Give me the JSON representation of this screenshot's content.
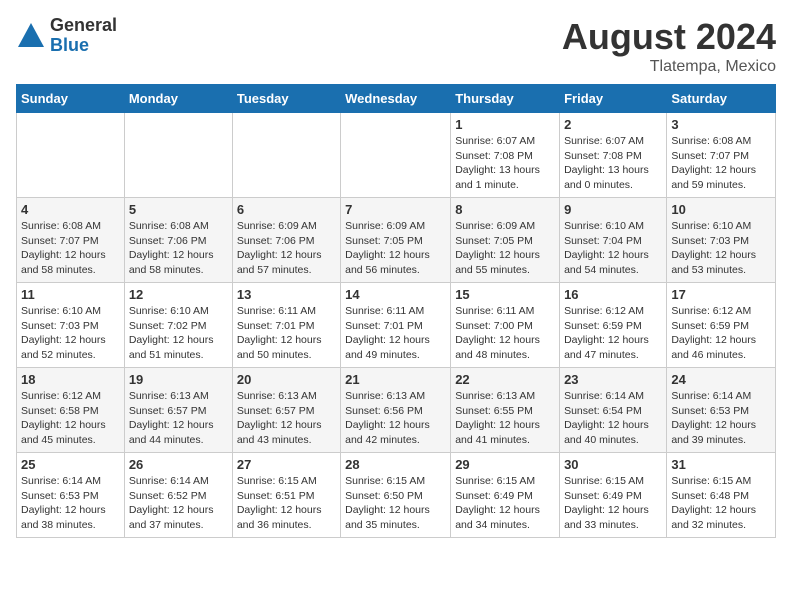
{
  "logo": {
    "general": "General",
    "blue": "Blue"
  },
  "title": {
    "month_year": "August 2024",
    "location": "Tlatempa, Mexico"
  },
  "days_of_week": [
    "Sunday",
    "Monday",
    "Tuesday",
    "Wednesday",
    "Thursday",
    "Friday",
    "Saturday"
  ],
  "weeks": [
    [
      {
        "day": "",
        "info": ""
      },
      {
        "day": "",
        "info": ""
      },
      {
        "day": "",
        "info": ""
      },
      {
        "day": "",
        "info": ""
      },
      {
        "day": "1",
        "info": "Sunrise: 6:07 AM\nSunset: 7:08 PM\nDaylight: 13 hours\nand 1 minute."
      },
      {
        "day": "2",
        "info": "Sunrise: 6:07 AM\nSunset: 7:08 PM\nDaylight: 13 hours\nand 0 minutes."
      },
      {
        "day": "3",
        "info": "Sunrise: 6:08 AM\nSunset: 7:07 PM\nDaylight: 12 hours\nand 59 minutes."
      }
    ],
    [
      {
        "day": "4",
        "info": "Sunrise: 6:08 AM\nSunset: 7:07 PM\nDaylight: 12 hours\nand 58 minutes."
      },
      {
        "day": "5",
        "info": "Sunrise: 6:08 AM\nSunset: 7:06 PM\nDaylight: 12 hours\nand 58 minutes."
      },
      {
        "day": "6",
        "info": "Sunrise: 6:09 AM\nSunset: 7:06 PM\nDaylight: 12 hours\nand 57 minutes."
      },
      {
        "day": "7",
        "info": "Sunrise: 6:09 AM\nSunset: 7:05 PM\nDaylight: 12 hours\nand 56 minutes."
      },
      {
        "day": "8",
        "info": "Sunrise: 6:09 AM\nSunset: 7:05 PM\nDaylight: 12 hours\nand 55 minutes."
      },
      {
        "day": "9",
        "info": "Sunrise: 6:10 AM\nSunset: 7:04 PM\nDaylight: 12 hours\nand 54 minutes."
      },
      {
        "day": "10",
        "info": "Sunrise: 6:10 AM\nSunset: 7:03 PM\nDaylight: 12 hours\nand 53 minutes."
      }
    ],
    [
      {
        "day": "11",
        "info": "Sunrise: 6:10 AM\nSunset: 7:03 PM\nDaylight: 12 hours\nand 52 minutes."
      },
      {
        "day": "12",
        "info": "Sunrise: 6:10 AM\nSunset: 7:02 PM\nDaylight: 12 hours\nand 51 minutes."
      },
      {
        "day": "13",
        "info": "Sunrise: 6:11 AM\nSunset: 7:01 PM\nDaylight: 12 hours\nand 50 minutes."
      },
      {
        "day": "14",
        "info": "Sunrise: 6:11 AM\nSunset: 7:01 PM\nDaylight: 12 hours\nand 49 minutes."
      },
      {
        "day": "15",
        "info": "Sunrise: 6:11 AM\nSunset: 7:00 PM\nDaylight: 12 hours\nand 48 minutes."
      },
      {
        "day": "16",
        "info": "Sunrise: 6:12 AM\nSunset: 6:59 PM\nDaylight: 12 hours\nand 47 minutes."
      },
      {
        "day": "17",
        "info": "Sunrise: 6:12 AM\nSunset: 6:59 PM\nDaylight: 12 hours\nand 46 minutes."
      }
    ],
    [
      {
        "day": "18",
        "info": "Sunrise: 6:12 AM\nSunset: 6:58 PM\nDaylight: 12 hours\nand 45 minutes."
      },
      {
        "day": "19",
        "info": "Sunrise: 6:13 AM\nSunset: 6:57 PM\nDaylight: 12 hours\nand 44 minutes."
      },
      {
        "day": "20",
        "info": "Sunrise: 6:13 AM\nSunset: 6:57 PM\nDaylight: 12 hours\nand 43 minutes."
      },
      {
        "day": "21",
        "info": "Sunrise: 6:13 AM\nSunset: 6:56 PM\nDaylight: 12 hours\nand 42 minutes."
      },
      {
        "day": "22",
        "info": "Sunrise: 6:13 AM\nSunset: 6:55 PM\nDaylight: 12 hours\nand 41 minutes."
      },
      {
        "day": "23",
        "info": "Sunrise: 6:14 AM\nSunset: 6:54 PM\nDaylight: 12 hours\nand 40 minutes."
      },
      {
        "day": "24",
        "info": "Sunrise: 6:14 AM\nSunset: 6:53 PM\nDaylight: 12 hours\nand 39 minutes."
      }
    ],
    [
      {
        "day": "25",
        "info": "Sunrise: 6:14 AM\nSunset: 6:53 PM\nDaylight: 12 hours\nand 38 minutes."
      },
      {
        "day": "26",
        "info": "Sunrise: 6:14 AM\nSunset: 6:52 PM\nDaylight: 12 hours\nand 37 minutes."
      },
      {
        "day": "27",
        "info": "Sunrise: 6:15 AM\nSunset: 6:51 PM\nDaylight: 12 hours\nand 36 minutes."
      },
      {
        "day": "28",
        "info": "Sunrise: 6:15 AM\nSunset: 6:50 PM\nDaylight: 12 hours\nand 35 minutes."
      },
      {
        "day": "29",
        "info": "Sunrise: 6:15 AM\nSunset: 6:49 PM\nDaylight: 12 hours\nand 34 minutes."
      },
      {
        "day": "30",
        "info": "Sunrise: 6:15 AM\nSunset: 6:49 PM\nDaylight: 12 hours\nand 33 minutes."
      },
      {
        "day": "31",
        "info": "Sunrise: 6:15 AM\nSunset: 6:48 PM\nDaylight: 12 hours\nand 32 minutes."
      }
    ]
  ]
}
